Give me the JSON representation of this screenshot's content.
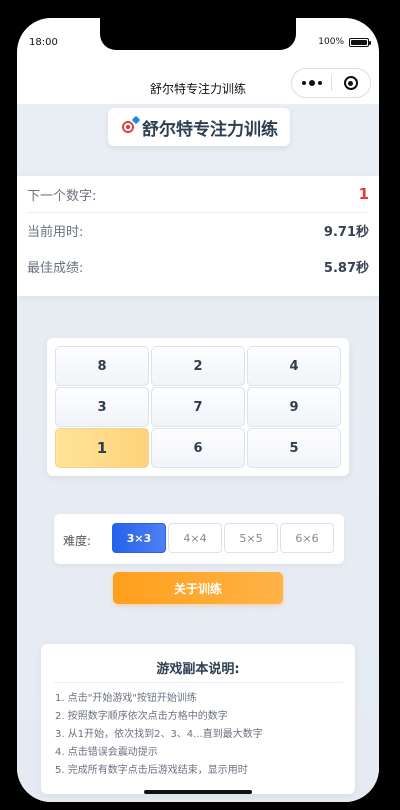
{
  "status_bar": {
    "time": "18:00",
    "battery": "100%"
  },
  "navbar": {
    "title": "舒尔特专注力训练"
  },
  "header": {
    "title": "舒尔特专注力训练"
  },
  "info": {
    "next_label": "下一个数字:",
    "next_value": "1",
    "current_label": "当前用时:",
    "current_value": "9.71秒",
    "best_label": "最佳成绩:",
    "best_value": "5.87秒"
  },
  "grid": {
    "cells": [
      "8",
      "2",
      "4",
      "3",
      "7",
      "9",
      "1",
      "6",
      "5"
    ],
    "highlighted": "1"
  },
  "difficulty": {
    "label": "难度:",
    "options": [
      "3×3",
      "4×4",
      "5×5",
      "6×6"
    ],
    "selected": "3×3"
  },
  "about_button": "关于训练",
  "rules": {
    "title": "游戏副本说明:",
    "items": [
      "1. 点击\"开始游戏\"按钮开始训练",
      "2. 按照数字顺序依次点击方格中的数字",
      "3. 从1开始，依次找到2、3、4...直到最大数字",
      "4. 点击错误会震动提示",
      "5. 完成所有数字点击后游戏结束，显示用时"
    ]
  },
  "colors": {
    "accent_blue": "#2563eb",
    "accent_orange": "#ff9f1a",
    "highlight_yellow": "#ffd27a",
    "next_number_red": "#e53935"
  }
}
